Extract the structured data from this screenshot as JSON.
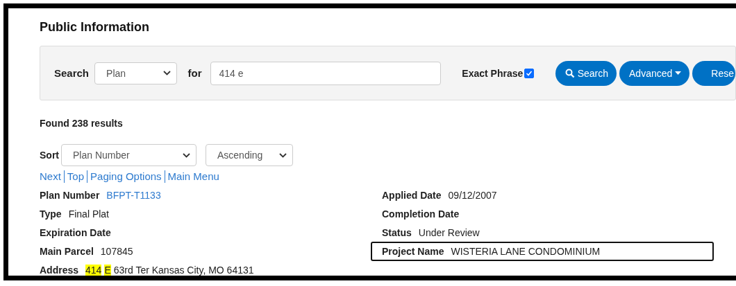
{
  "page_title": "Public Information",
  "search": {
    "label": "Search",
    "type_select": "Plan",
    "for_label": "for",
    "query": "414 e",
    "exact_phrase": {
      "label": "Exact Phrase",
      "checked": true
    },
    "buttons": [
      {
        "kind": "search",
        "label": "Search"
      },
      {
        "kind": "dropdown",
        "label": "Advanced"
      },
      {
        "kind": "plain",
        "label": "Rese"
      }
    ]
  },
  "results_count": "Found 238 results",
  "sort": {
    "label": "Sort",
    "field": "Plan Number",
    "order": "Ascending"
  },
  "nav_links": [
    "Next",
    "Top",
    "Paging Options",
    "Main Menu"
  ],
  "record": {
    "left": [
      {
        "label": "Plan Number",
        "value": [
          {
            "text": "BFPT-T1133",
            "kind": "link"
          }
        ]
      },
      {
        "label": "Type",
        "value": [
          {
            "text": "Final Plat",
            "kind": "text"
          }
        ]
      },
      {
        "label": "Expiration Date"
      },
      {
        "label": "Main Parcel",
        "value": [
          {
            "text": "107845",
            "kind": "text"
          }
        ]
      },
      {
        "label": "Address",
        "value": [
          {
            "text": "414",
            "kind": "highlight"
          },
          {
            "text": "E",
            "kind": "highlight"
          },
          {
            "text": "63rd Ter Kansas City, MO 64131",
            "kind": "text"
          }
        ]
      }
    ],
    "right": [
      {
        "label": "Applied Date",
        "value": [
          {
            "text": "09/12/2007",
            "kind": "text"
          }
        ],
        "outlined": false
      },
      {
        "label": "Completion Date",
        "outlined": false
      },
      {
        "label": "Status",
        "value": [
          {
            "text": "Under Review",
            "kind": "text"
          }
        ],
        "outlined": false
      },
      {
        "label": "Project Name",
        "value": [
          {
            "text": "WISTERIA LANE CONDOMINIUM",
            "kind": "text"
          }
        ],
        "outlined": true
      }
    ]
  }
}
